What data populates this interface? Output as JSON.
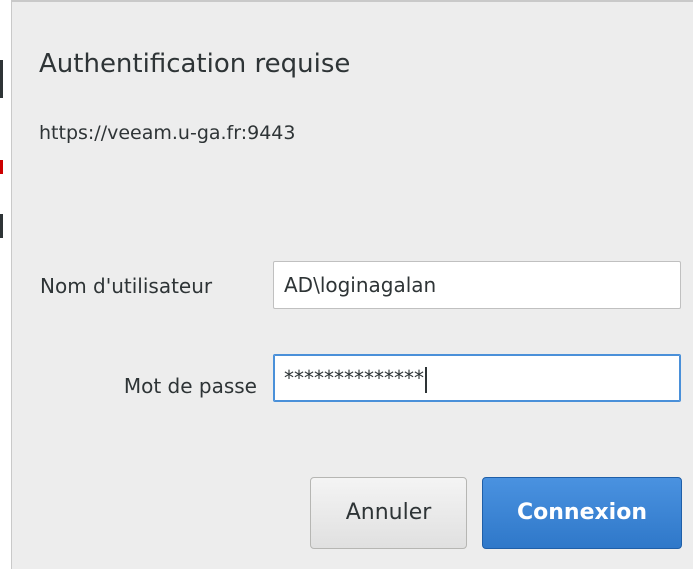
{
  "dialog": {
    "title": "Authentification requise",
    "url": "https://veeam.u-ga.fr:9443"
  },
  "form": {
    "username_label": "Nom d'utilisateur",
    "username_value": "AD\\loginagalan",
    "password_label": "Mot de passe",
    "password_masked": "**************"
  },
  "buttons": {
    "cancel_label": "Annuler",
    "connect_label": "Connexion"
  },
  "colors": {
    "accent": "#3584e4",
    "focus_border": "#4a90d9"
  }
}
